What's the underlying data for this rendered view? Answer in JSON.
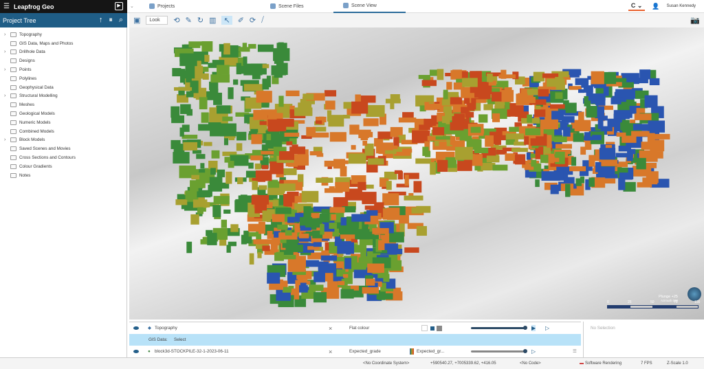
{
  "app": {
    "title": "Leapfrog Geo"
  },
  "tabs": [
    {
      "label": "Projects",
      "icon": "projects-icon"
    },
    {
      "label": "Scene Files",
      "icon": "scene-files-icon"
    },
    {
      "label": "Scene View",
      "icon": "scene-view-icon",
      "active": true
    }
  ],
  "user": {
    "name": "Susan Kennedy"
  },
  "project_tree": {
    "title": "Project Tree",
    "items": [
      {
        "label": "Topography",
        "expandable": true
      },
      {
        "label": "GIS Data, Maps and Photos",
        "expandable": false
      },
      {
        "label": "Drillhole Data",
        "expandable": true
      },
      {
        "label": "Designs",
        "expandable": false
      },
      {
        "label": "Points",
        "expandable": true
      },
      {
        "label": "Polylines",
        "expandable": false
      },
      {
        "label": "Geophysical Data",
        "expandable": false
      },
      {
        "label": "Structural Modelling",
        "expandable": true
      },
      {
        "label": "Meshes",
        "expandable": false
      },
      {
        "label": "Geological Models",
        "expandable": false
      },
      {
        "label": "Numeric Models",
        "expandable": false
      },
      {
        "label": "Combined Models",
        "expandable": false
      },
      {
        "label": "Block Models",
        "expandable": true
      },
      {
        "label": "Saved Scenes and Movies",
        "expandable": false
      },
      {
        "label": "Cross Sections and Contours",
        "expandable": false
      },
      {
        "label": "Colour Gradients",
        "expandable": false
      },
      {
        "label": "Notes",
        "expandable": false
      }
    ]
  },
  "toolbar": {
    "mode": "Look"
  },
  "viewport": {
    "plunge": "Plunge +25",
    "azimuth": "Azimuth 029",
    "scale_labels": [
      "0",
      "25",
      "50",
      "75",
      "100"
    ],
    "block_colors": [
      "#2a55b0",
      "#3a8a3a",
      "#6aa030",
      "#a8a030",
      "#d8782a",
      "#c8481e"
    ]
  },
  "layers": [
    {
      "name": "Topography",
      "style": "Flat colour",
      "gradient": ""
    },
    {
      "gis_label": "GIS Data:",
      "gis_value": "Select"
    },
    {
      "name": "block3d-STOCKPILE-32-1-2023-06-11",
      "style": "Expected_grade",
      "gradient": "Expected_gr..."
    }
  ],
  "selection": {
    "text": "No Selection"
  },
  "status": {
    "coord_system": "<No Coordinate System>",
    "coords": "+590540.27, +7005339.62, +416.05",
    "code": "<No Code>",
    "rendering": "Software Rendering",
    "fps": "7 FPS",
    "zscale": "Z-Scale 1.0"
  }
}
